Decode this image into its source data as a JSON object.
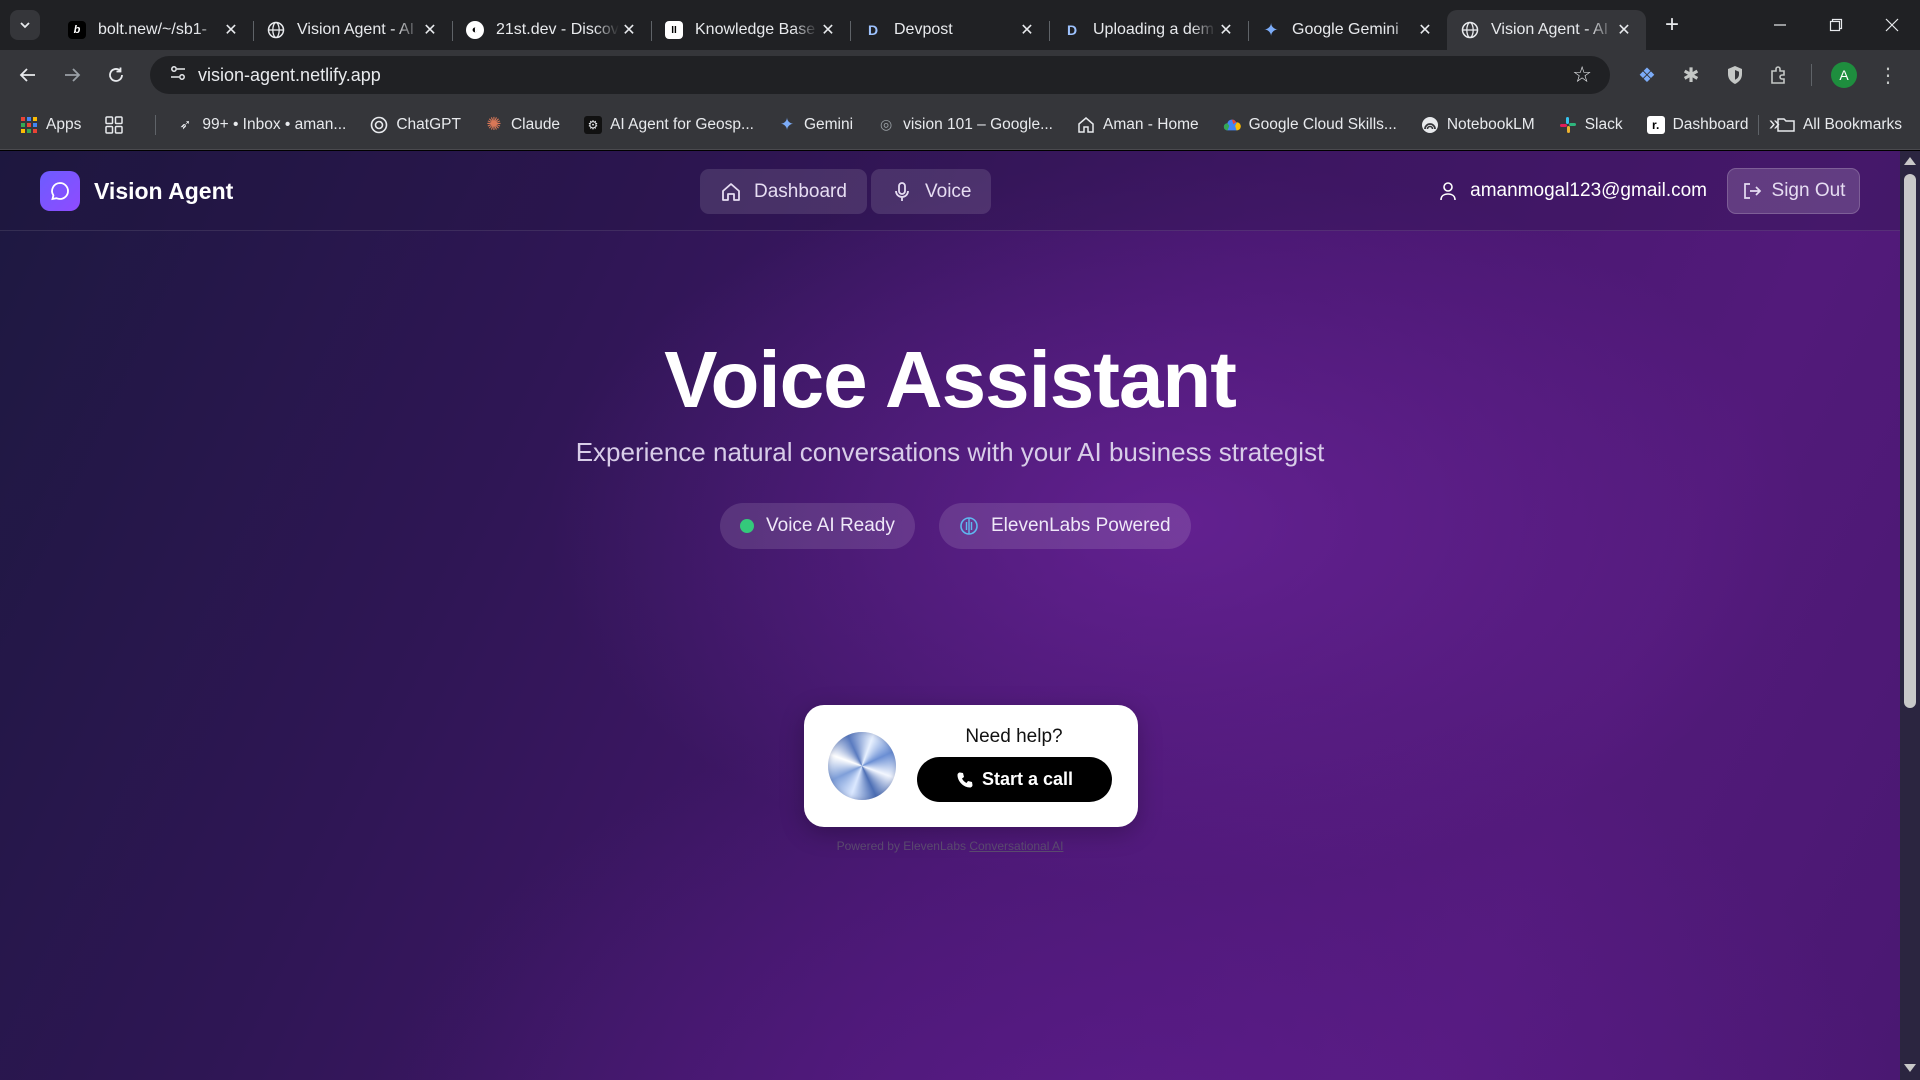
{
  "browser": {
    "tabs": [
      {
        "title": "bolt.new/~/sb1-",
        "favicon": "b",
        "fav_bg": "#000000",
        "fav_fg": "#ffffff",
        "active": false
      },
      {
        "title": "Vision Agent - AI",
        "favicon": "globe-icon",
        "fav_bg": "transparent",
        "fav_fg": "#e8eaed",
        "active": false
      },
      {
        "title": "21st.dev - Discov",
        "favicon": "21st-icon",
        "fav_bg": "#ffffff",
        "fav_fg": "#000000",
        "active": false
      },
      {
        "title": "Knowledge Base",
        "favicon": "II",
        "fav_bg": "#ffffff",
        "fav_fg": "#000000",
        "active": false
      },
      {
        "title": "Devpost",
        "favicon": "D",
        "fav_bg": "transparent",
        "fav_fg": "#9ec3ff",
        "active": false
      },
      {
        "title": "Uploading a dem",
        "favicon": "D",
        "fav_bg": "transparent",
        "fav_fg": "#9ec3ff",
        "active": false
      },
      {
        "title": "Google Gemini",
        "favicon": "gemini-icon",
        "fav_bg": "transparent",
        "fav_fg": "#7cacf8",
        "active": false
      },
      {
        "title": "Vision Agent - AI",
        "favicon": "globe-icon",
        "fav_bg": "transparent",
        "fav_fg": "#e8eaed",
        "active": true
      }
    ],
    "url": "vision-agent.netlify.app",
    "profile_initial": "A",
    "bookmarks": [
      {
        "label": "Apps",
        "icon": "apps-grid-icon"
      },
      {
        "label": "",
        "icon": "tab-groups-icon"
      },
      {
        "label": "99+ • Inbox • aman...",
        "icon": "send-icon"
      },
      {
        "label": "ChatGPT",
        "icon": "chatgpt-icon"
      },
      {
        "label": "Claude",
        "icon": "claude-icon"
      },
      {
        "label": "AI Agent for Geosp...",
        "icon": "geo-icon"
      },
      {
        "label": "Gemini",
        "icon": "gemini-icon"
      },
      {
        "label": "vision 101 – Google...",
        "icon": "google-icon"
      },
      {
        "label": "Aman - Home",
        "icon": "home-icon"
      },
      {
        "label": "Google Cloud Skills...",
        "icon": "cloud-icon"
      },
      {
        "label": "NotebookLM",
        "icon": "notebook-icon"
      },
      {
        "label": "Slack",
        "icon": "slack-icon"
      },
      {
        "label": "Dashboard",
        "icon": "dashboard-icon"
      }
    ],
    "all_bookmarks": "All Bookmarks"
  },
  "app": {
    "brand": "Vision Agent",
    "nav": [
      {
        "label": "Dashboard",
        "icon": "home-icon"
      },
      {
        "label": "Voice",
        "icon": "mic-icon"
      }
    ],
    "user_email": "amanmogal123@gmail.com",
    "sign_out": "Sign Out"
  },
  "hero": {
    "title": "Voice Assistant",
    "subtitle": "Experience natural conversations with your AI business strategist",
    "badges": [
      {
        "label": "Voice AI Ready",
        "icon": "status-dot",
        "color": "#34c97b"
      },
      {
        "label": "ElevenLabs Powered",
        "icon": "elevenlabs-icon",
        "color": "#5fb8f0"
      }
    ]
  },
  "widget": {
    "title": "Need help?",
    "button": "Start a call",
    "powered_prefix": "Powered by ElevenLabs",
    "powered_link": "Conversational AI"
  }
}
